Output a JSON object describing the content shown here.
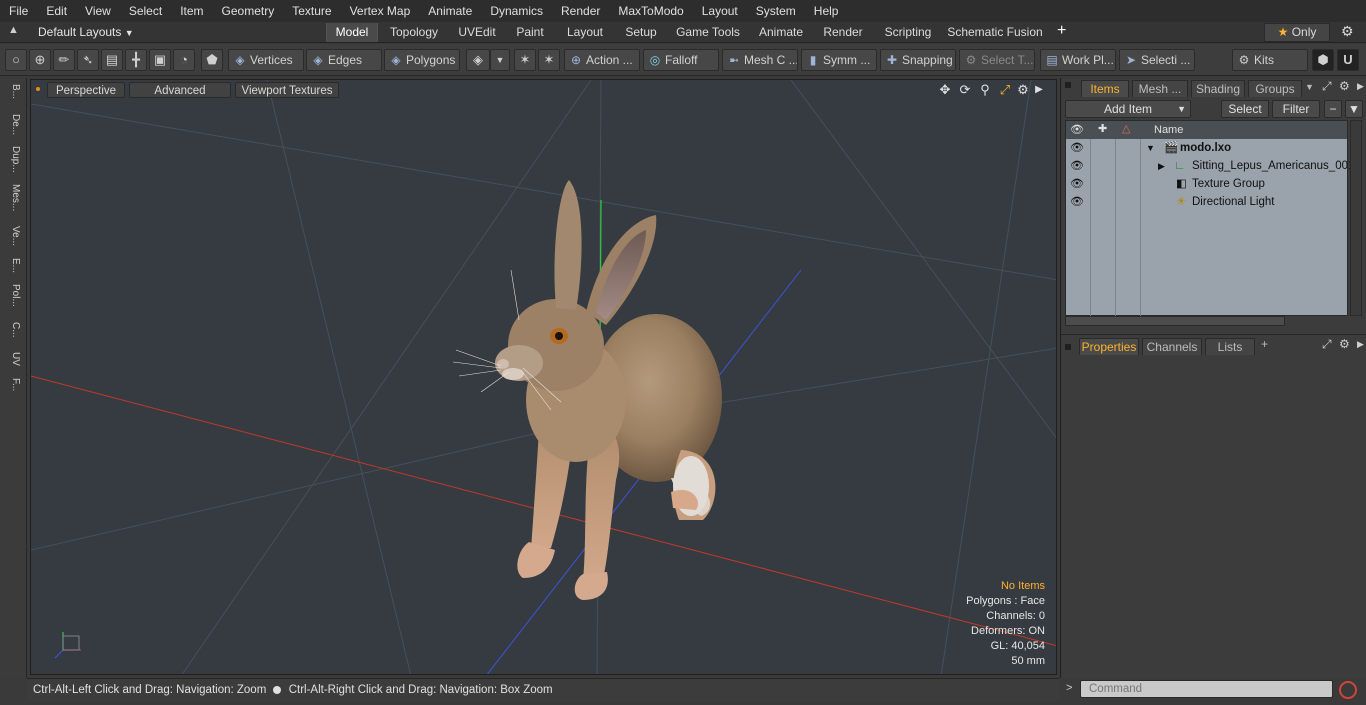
{
  "menu": [
    "File",
    "Edit",
    "View",
    "Select",
    "Item",
    "Geometry",
    "Texture",
    "Vertex Map",
    "Animate",
    "Dynamics",
    "Render",
    "MaxToModo",
    "Layout",
    "System",
    "Help"
  ],
  "layouts": {
    "selector": "Default Layouts",
    "tabs": [
      "Model",
      "Topology",
      "UVEdit",
      "Paint",
      "Layout",
      "Setup",
      "Game Tools",
      "Animate",
      "Render",
      "Scripting",
      "Schematic Fusion"
    ],
    "active_tab": "Model",
    "only_label": "Only"
  },
  "toolbar": {
    "vertices": "Vertices",
    "edges": "Edges",
    "polygons": "Polygons",
    "action": "Action ...",
    "falloff": "Falloff",
    "mesh": "Mesh C ...",
    "symm": "Symm ...",
    "snapping": "Snapping",
    "select_t": "Select T...",
    "work_pl": "Work Pl...",
    "selecti": "Selecti ...",
    "kits": "Kits"
  },
  "left_strip": [
    "B...",
    "De...",
    "Dup...",
    "Mes...",
    "Ve...",
    "E...",
    "Pol...",
    "C...",
    "UV",
    "F..."
  ],
  "viewport": {
    "buttons": [
      "Perspective",
      "Advanced",
      "Viewport Textures"
    ],
    "info": {
      "selection": "No Items",
      "polygons": "Polygons : Face",
      "channels": "Channels: 0",
      "deformers": "Deformers: ON",
      "gl": "GL: 40,054",
      "distance": "50 mm"
    }
  },
  "status": {
    "hint_zoom": "Ctrl-Alt-Left Click and Drag: Navigation: Zoom",
    "hint_box": "Ctrl-Alt-Right Click and Drag: Navigation: Box Zoom"
  },
  "items_panel": {
    "tabs": [
      "Items",
      "Mesh ...",
      "Shading",
      "Groups"
    ],
    "active_tab": "Items",
    "add_item": "Add Item",
    "select": "Select",
    "filter": "Filter",
    "column_name": "Name",
    "rows": [
      {
        "label": "modo.lxo",
        "bold": true
      },
      {
        "label": "Sitting_Lepus_Americanus_001",
        "bold": false
      },
      {
        "label": "Texture Group",
        "bold": false
      },
      {
        "label": "Directional Light",
        "bold": false
      }
    ]
  },
  "properties_panel": {
    "tabs": [
      "Properties",
      "Channels",
      "Lists"
    ],
    "active_tab": "Properties"
  },
  "command": {
    "placeholder": "Command"
  },
  "colors": {
    "accent": "#ffb22d",
    "viewport_bg": "#353b40",
    "x_axis": "#c0392b",
    "y_axis": "#2ecc40",
    "z_axis": "#3a55d8"
  }
}
